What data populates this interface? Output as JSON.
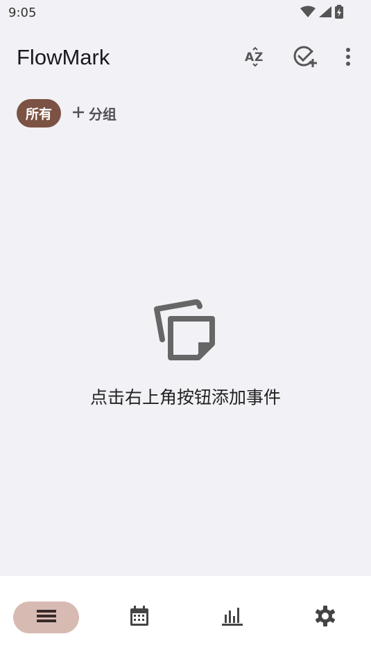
{
  "status": {
    "time": "9:05"
  },
  "app": {
    "title": "FlowMark"
  },
  "actions": [
    {
      "name": "sort-az-icon"
    },
    {
      "name": "add-task-icon"
    },
    {
      "name": "more-vert-icon"
    }
  ],
  "chips": {
    "all_label": "所有",
    "add_group_label": "分组"
  },
  "empty": {
    "message": "点击右上角按钮添加事件"
  },
  "nav": [
    {
      "name": "list-icon",
      "active": true
    },
    {
      "name": "calendar-icon",
      "active": false
    },
    {
      "name": "stats-icon",
      "active": false
    },
    {
      "name": "settings-icon",
      "active": false
    }
  ],
  "colors": {
    "background": "#f1f1f6",
    "chip_active": "#7b5243",
    "nav_active": "#d7bbb3",
    "icon": "#555555"
  }
}
